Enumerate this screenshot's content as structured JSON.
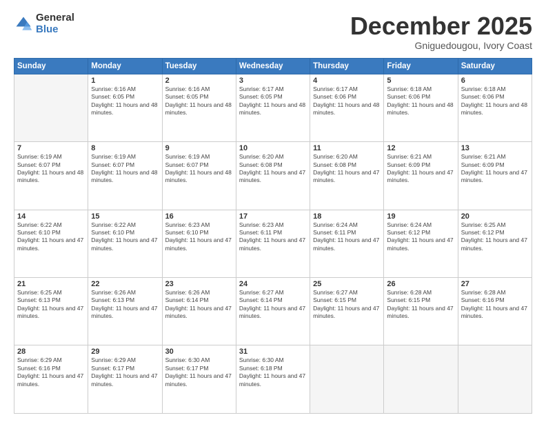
{
  "logo": {
    "general": "General",
    "blue": "Blue"
  },
  "header": {
    "month": "December 2025",
    "location": "Gniguedougou, Ivory Coast"
  },
  "weekdays": [
    "Sunday",
    "Monday",
    "Tuesday",
    "Wednesday",
    "Thursday",
    "Friday",
    "Saturday"
  ],
  "weeks": [
    [
      {
        "day": "",
        "empty": true
      },
      {
        "day": "1",
        "sunrise": "6:16 AM",
        "sunset": "6:05 PM",
        "daylight": "11 hours and 48 minutes."
      },
      {
        "day": "2",
        "sunrise": "6:16 AM",
        "sunset": "6:05 PM",
        "daylight": "11 hours and 48 minutes."
      },
      {
        "day": "3",
        "sunrise": "6:17 AM",
        "sunset": "6:05 PM",
        "daylight": "11 hours and 48 minutes."
      },
      {
        "day": "4",
        "sunrise": "6:17 AM",
        "sunset": "6:06 PM",
        "daylight": "11 hours and 48 minutes."
      },
      {
        "day": "5",
        "sunrise": "6:18 AM",
        "sunset": "6:06 PM",
        "daylight": "11 hours and 48 minutes."
      },
      {
        "day": "6",
        "sunrise": "6:18 AM",
        "sunset": "6:06 PM",
        "daylight": "11 hours and 48 minutes."
      }
    ],
    [
      {
        "day": "7",
        "sunrise": "6:19 AM",
        "sunset": "6:07 PM",
        "daylight": "11 hours and 48 minutes."
      },
      {
        "day": "8",
        "sunrise": "6:19 AM",
        "sunset": "6:07 PM",
        "daylight": "11 hours and 48 minutes."
      },
      {
        "day": "9",
        "sunrise": "6:19 AM",
        "sunset": "6:07 PM",
        "daylight": "11 hours and 48 minutes."
      },
      {
        "day": "10",
        "sunrise": "6:20 AM",
        "sunset": "6:08 PM",
        "daylight": "11 hours and 47 minutes."
      },
      {
        "day": "11",
        "sunrise": "6:20 AM",
        "sunset": "6:08 PM",
        "daylight": "11 hours and 47 minutes."
      },
      {
        "day": "12",
        "sunrise": "6:21 AM",
        "sunset": "6:09 PM",
        "daylight": "11 hours and 47 minutes."
      },
      {
        "day": "13",
        "sunrise": "6:21 AM",
        "sunset": "6:09 PM",
        "daylight": "11 hours and 47 minutes."
      }
    ],
    [
      {
        "day": "14",
        "sunrise": "6:22 AM",
        "sunset": "6:10 PM",
        "daylight": "11 hours and 47 minutes."
      },
      {
        "day": "15",
        "sunrise": "6:22 AM",
        "sunset": "6:10 PM",
        "daylight": "11 hours and 47 minutes."
      },
      {
        "day": "16",
        "sunrise": "6:23 AM",
        "sunset": "6:10 PM",
        "daylight": "11 hours and 47 minutes."
      },
      {
        "day": "17",
        "sunrise": "6:23 AM",
        "sunset": "6:11 PM",
        "daylight": "11 hours and 47 minutes."
      },
      {
        "day": "18",
        "sunrise": "6:24 AM",
        "sunset": "6:11 PM",
        "daylight": "11 hours and 47 minutes."
      },
      {
        "day": "19",
        "sunrise": "6:24 AM",
        "sunset": "6:12 PM",
        "daylight": "11 hours and 47 minutes."
      },
      {
        "day": "20",
        "sunrise": "6:25 AM",
        "sunset": "6:12 PM",
        "daylight": "11 hours and 47 minutes."
      }
    ],
    [
      {
        "day": "21",
        "sunrise": "6:25 AM",
        "sunset": "6:13 PM",
        "daylight": "11 hours and 47 minutes."
      },
      {
        "day": "22",
        "sunrise": "6:26 AM",
        "sunset": "6:13 PM",
        "daylight": "11 hours and 47 minutes."
      },
      {
        "day": "23",
        "sunrise": "6:26 AM",
        "sunset": "6:14 PM",
        "daylight": "11 hours and 47 minutes."
      },
      {
        "day": "24",
        "sunrise": "6:27 AM",
        "sunset": "6:14 PM",
        "daylight": "11 hours and 47 minutes."
      },
      {
        "day": "25",
        "sunrise": "6:27 AM",
        "sunset": "6:15 PM",
        "daylight": "11 hours and 47 minutes."
      },
      {
        "day": "26",
        "sunrise": "6:28 AM",
        "sunset": "6:15 PM",
        "daylight": "11 hours and 47 minutes."
      },
      {
        "day": "27",
        "sunrise": "6:28 AM",
        "sunset": "6:16 PM",
        "daylight": "11 hours and 47 minutes."
      }
    ],
    [
      {
        "day": "28",
        "sunrise": "6:29 AM",
        "sunset": "6:16 PM",
        "daylight": "11 hours and 47 minutes."
      },
      {
        "day": "29",
        "sunrise": "6:29 AM",
        "sunset": "6:17 PM",
        "daylight": "11 hours and 47 minutes."
      },
      {
        "day": "30",
        "sunrise": "6:30 AM",
        "sunset": "6:17 PM",
        "daylight": "11 hours and 47 minutes."
      },
      {
        "day": "31",
        "sunrise": "6:30 AM",
        "sunset": "6:18 PM",
        "daylight": "11 hours and 47 minutes."
      },
      {
        "day": "",
        "empty": true
      },
      {
        "day": "",
        "empty": true
      },
      {
        "day": "",
        "empty": true
      }
    ]
  ]
}
